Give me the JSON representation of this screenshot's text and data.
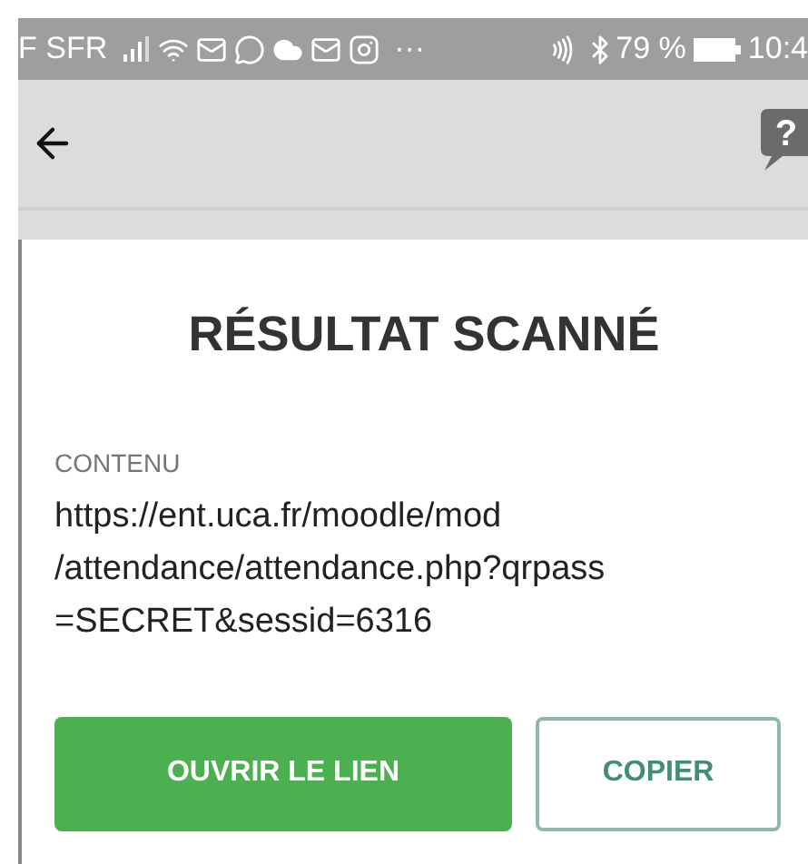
{
  "status_bar": {
    "carrier": "F SFR",
    "more": "···",
    "battery": "79 %",
    "time": "10:4"
  },
  "app_bar": {
    "help": "?"
  },
  "card": {
    "title": "RÉSULTAT SCANNÉ",
    "label": "CONTENU",
    "lines": [
      "https://ent.uca.fr/moodle/mod",
      "/attendance/attendance.php?qrpass",
      "=SECRET&sessid=6316"
    ]
  },
  "buttons": [
    {
      "label": "OUVRIR LE LIEN",
      "kind": "primary"
    },
    {
      "label": "COPIER",
      "kind": "outline"
    }
  ]
}
